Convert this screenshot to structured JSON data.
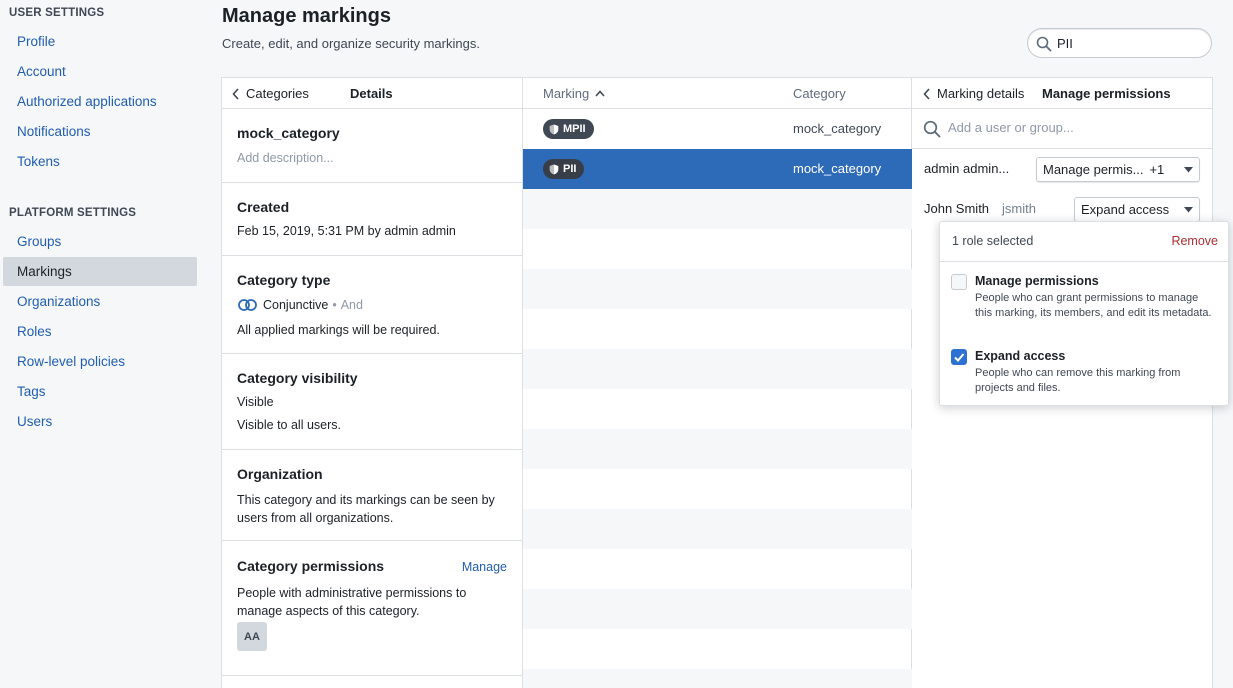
{
  "sidebar": {
    "user_settings_label": "USER SETTINGS",
    "user_items": [
      {
        "label": "Profile"
      },
      {
        "label": "Account"
      },
      {
        "label": "Authorized applications"
      },
      {
        "label": "Notifications"
      },
      {
        "label": "Tokens"
      }
    ],
    "platform_settings_label": "PLATFORM SETTINGS",
    "platform_items": [
      {
        "label": "Groups"
      },
      {
        "label": "Markings"
      },
      {
        "label": "Organizations"
      },
      {
        "label": "Roles"
      },
      {
        "label": "Row-level policies"
      },
      {
        "label": "Tags"
      },
      {
        "label": "Users"
      }
    ],
    "active_item": "Markings"
  },
  "header": {
    "title": "Manage markings",
    "subtitle": "Create, edit, and organize security markings.",
    "search_value": "PII"
  },
  "details": {
    "back_label": "Categories",
    "title": "Details",
    "name": "mock_category",
    "description_placeholder": "Add description...",
    "created_label": "Created",
    "created_value": "Feb 15, 2019, 5:31 PM by admin admin",
    "type_label": "Category type",
    "type_value": "Conjunctive",
    "type_sep": "•",
    "type_suffix": "And",
    "type_desc": "All applied markings will be required.",
    "visibility_label": "Category visibility",
    "visibility_value": "Visible",
    "visibility_desc": "Visible to all users.",
    "org_label": "Organization",
    "org_desc": "This category and its markings can be seen by users from all organizations.",
    "perm_label": "Category permissions",
    "perm_manage": "Manage",
    "perm_desc": "People with administrative permissions to manage aspects of this category.",
    "avatar": "AA"
  },
  "markings": {
    "col_marking": "Marking",
    "col_category": "Category",
    "rows": [
      {
        "marking": "MPII",
        "category": "mock_category"
      },
      {
        "marking": "PII",
        "category": "mock_category"
      }
    ]
  },
  "permissions": {
    "back_label": "Marking details",
    "title": "Manage permissions",
    "add_placeholder": "Add a user or group...",
    "members": [
      {
        "name": "admin admin...",
        "username": "",
        "role": "Manage permis...",
        "extra": "+1"
      },
      {
        "name": "John Smith",
        "username": "jsmith",
        "role": "Expand access",
        "extra": ""
      }
    ]
  },
  "popover": {
    "count": "1 role selected",
    "remove": "Remove",
    "options": [
      {
        "title": "Manage permissions",
        "desc": "People who can grant permissions to manage this marking, its members, and edit its metadata.",
        "checked": false
      },
      {
        "title": "Expand access",
        "desc": "People who can remove this marking from projects and files.",
        "checked": true
      }
    ]
  },
  "colors": {
    "accent": "#2d6ab8",
    "link": "#215db0",
    "danger": "#ac2f33"
  }
}
